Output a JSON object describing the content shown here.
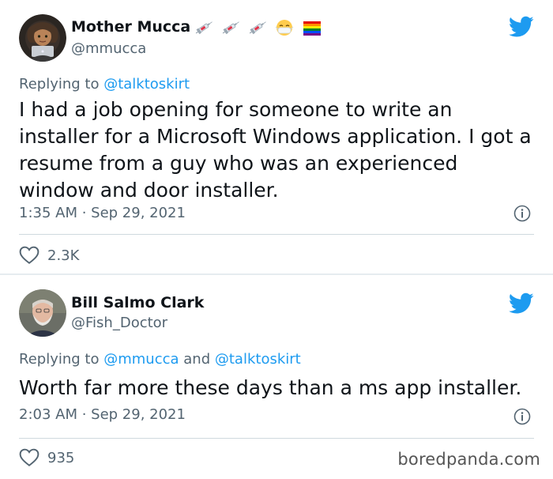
{
  "tweets": [
    {
      "user_name": "Mother Mucca",
      "handle": "@mmucca",
      "emojis": [
        "syringe-icon",
        "syringe-icon",
        "syringe-icon",
        "mask-face-icon",
        "rainbow-flag-icon"
      ],
      "replying_prefix": "Replying to",
      "replying_to": "@talktoskirt",
      "body": "I had a job opening for someone to write an installer for a Microsoft Windows application. I got a resume from a guy who was an experienced window and door installer.",
      "timestamp": "1:35 AM · Sep 29, 2021",
      "likes": "2.3K"
    },
    {
      "user_name": "Bill Salmo Clark",
      "handle": "@Fish_Doctor",
      "replying_prefix": "Replying to",
      "replying_to_1": "@mmucca",
      "replying_and": "and",
      "replying_to_2": "@talktoskirt",
      "body": "Worth far more these days than a ms app installer.",
      "timestamp": "2:03 AM · Sep 29, 2021",
      "likes": "935"
    }
  ],
  "watermark": "boredpanda.com",
  "colors": {
    "text": "#0f1419",
    "muted": "#536471",
    "link": "#1d9bf0",
    "twitter_blue": "#1d9bf0"
  }
}
